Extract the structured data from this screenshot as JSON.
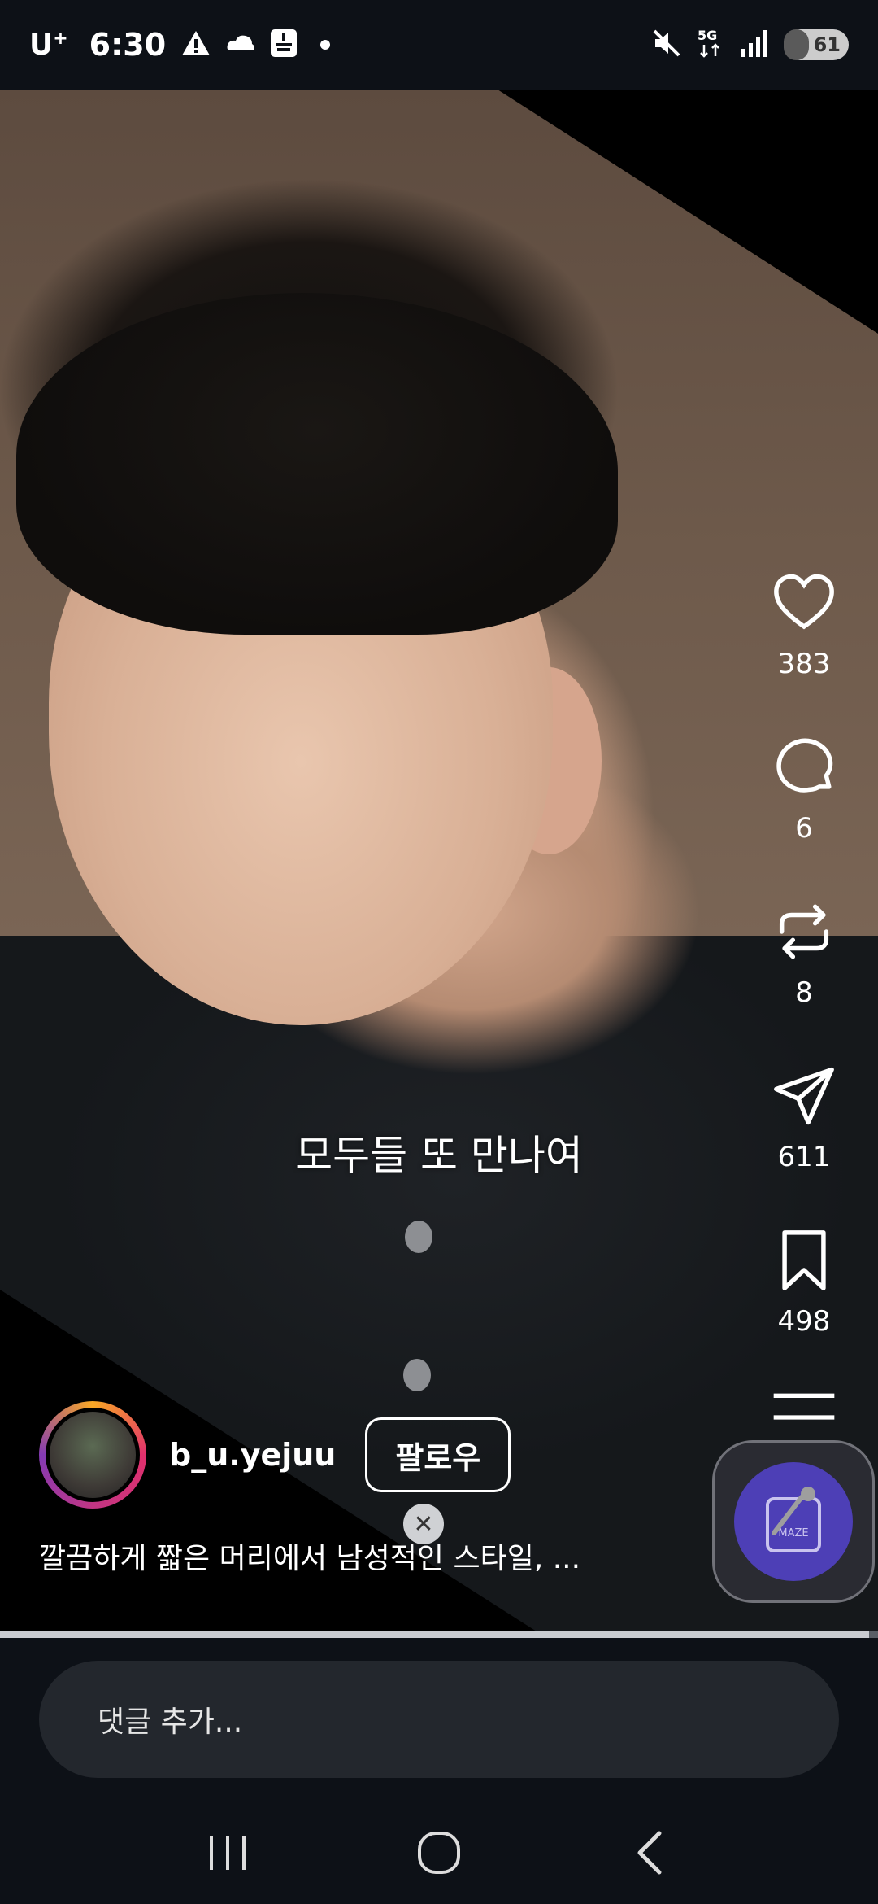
{
  "status_bar": {
    "carrier": "U",
    "carrier_sup": "+",
    "time": "6:30",
    "network": "5G",
    "battery": "61",
    "battery_level": 0.61
  },
  "video": {
    "subtitle": "모두들 또 만나여",
    "progress": 0.99
  },
  "actions": [
    {
      "name": "like",
      "icon": "heart-icon",
      "count": "383"
    },
    {
      "name": "comment",
      "icon": "comment-icon",
      "count": "6"
    },
    {
      "name": "repost",
      "icon": "repost-icon",
      "count": "8"
    },
    {
      "name": "share",
      "icon": "send-icon",
      "count": "611"
    },
    {
      "name": "save",
      "icon": "bookmark-icon",
      "count": "498"
    }
  ],
  "author": {
    "username": "b_u.yejuu",
    "follow_label": "팔로우"
  },
  "caption": "깔끔하게 짧은 머리에서 남성적인 스타일, ...",
  "comment": {
    "placeholder": "댓글 추가..."
  },
  "floating_widget": {
    "label": "MAZE"
  },
  "colors": {
    "background": "#0d1117",
    "floating_accent": "#4d3fb6",
    "comment_bg": "#23272d"
  }
}
